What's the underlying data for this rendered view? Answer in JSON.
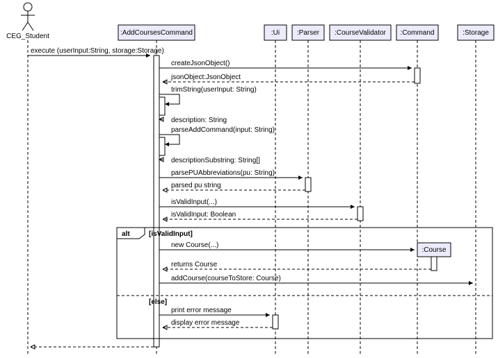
{
  "actor": "CEG_Student",
  "participants": {
    "p1": ":AddCoursesCommand",
    "p2": ":Ui",
    "p3": ":Parser",
    "p4": ":CourseValidator",
    "p5": ":Command",
    "p6": ":Storage",
    "p7": ":Course"
  },
  "messages": {
    "m1": "execute (userInput:String, storage:Storage)",
    "m2": "createJsonObject()",
    "m3": "jsonObject:JsonObject",
    "m4": "trimString(userInput: String)",
    "m5": "description: String",
    "m6": "parseAddCommand(input: String)",
    "m7": "descriptionSubstring: String[]",
    "m8": "parsePUAbbreviations(pu: String)",
    "m9": "parsed pu string",
    "m10": "isValidInput(...)",
    "m11": "isValidInput: Boolean",
    "m12": "new Course(...)",
    "m13": "returns Course",
    "m14": "addCourse(courseToStore: Course)",
    "m15": "print error message",
    "m16": "display error message"
  },
  "frame": {
    "kw": "alt",
    "g1": "[isValidInput]",
    "g2": "[else]"
  },
  "chart_data": {
    "type": "sequence-diagram",
    "actor": "CEG_Student",
    "participants": [
      ":AddCoursesCommand",
      ":Ui",
      ":Parser",
      ":CourseValidator",
      ":Command",
      ":Course",
      ":Storage"
    ],
    "messages": [
      {
        "from": "CEG_Student",
        "to": ":AddCoursesCommand",
        "text": "execute (userInput:String, storage:Storage)",
        "type": "sync"
      },
      {
        "from": ":AddCoursesCommand",
        "to": ":Command",
        "text": "createJsonObject()",
        "type": "sync"
      },
      {
        "from": ":Command",
        "to": ":AddCoursesCommand",
        "text": "jsonObject:JsonObject",
        "type": "return"
      },
      {
        "from": ":AddCoursesCommand",
        "to": ":AddCoursesCommand",
        "text": "trimString(userInput: String)",
        "type": "self"
      },
      {
        "from": ":AddCoursesCommand",
        "to": ":AddCoursesCommand",
        "text": "description: String",
        "type": "self-return"
      },
      {
        "from": ":AddCoursesCommand",
        "to": ":AddCoursesCommand",
        "text": "parseAddCommand(input: String)",
        "type": "self"
      },
      {
        "from": ":AddCoursesCommand",
        "to": ":AddCoursesCommand",
        "text": "descriptionSubstring: String[]",
        "type": "self-return"
      },
      {
        "from": ":AddCoursesCommand",
        "to": ":Parser",
        "text": "parsePUAbbreviations(pu: String)",
        "type": "sync"
      },
      {
        "from": ":Parser",
        "to": ":AddCoursesCommand",
        "text": "parsed pu string",
        "type": "return"
      },
      {
        "from": ":AddCoursesCommand",
        "to": ":CourseValidator",
        "text": "isValidInput(...)",
        "type": "sync"
      },
      {
        "from": ":CourseValidator",
        "to": ":AddCoursesCommand",
        "text": "isValidInput: Boolean",
        "type": "return"
      }
    ],
    "alt": {
      "guard": "isValidInput",
      "then": [
        {
          "from": ":AddCoursesCommand",
          "to": ":Course",
          "text": "new Course(...)",
          "type": "create"
        },
        {
          "from": ":Course",
          "to": ":AddCoursesCommand",
          "text": "returns Course",
          "type": "return"
        },
        {
          "from": ":AddCoursesCommand",
          "to": ":Storage",
          "text": "addCourse(courseToStore: Course)",
          "type": "sync"
        }
      ],
      "else": [
        {
          "from": ":AddCoursesCommand",
          "to": ":Ui",
          "text": "print error message",
          "type": "sync"
        },
        {
          "from": ":Ui",
          "to": ":AddCoursesCommand",
          "text": "display error message",
          "type": "return"
        }
      ]
    },
    "final_return": {
      "from": ":AddCoursesCommand",
      "to": "CEG_Student",
      "type": "return"
    }
  }
}
